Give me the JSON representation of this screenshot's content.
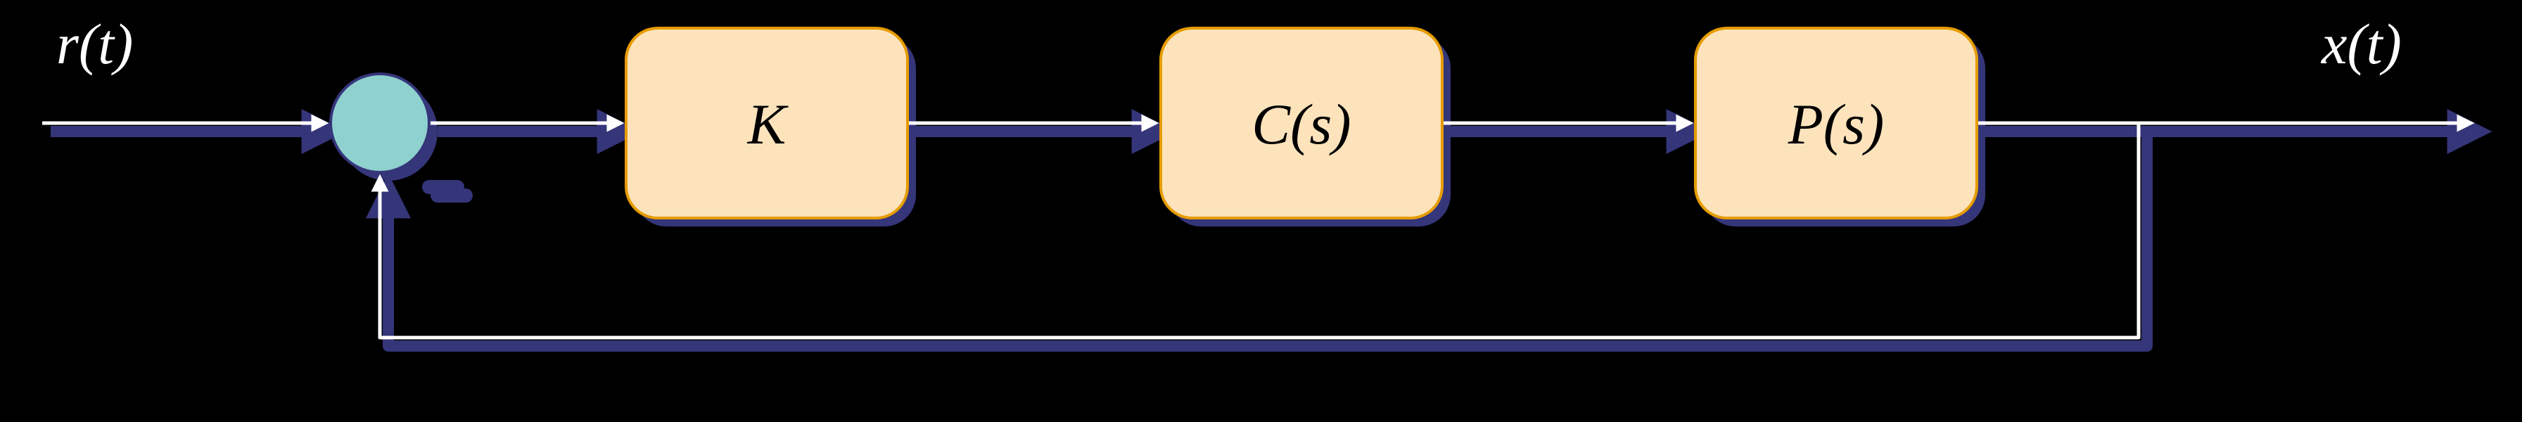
{
  "diagram": {
    "type": "control-system-block-diagram",
    "input_label": "r(t)",
    "output_label": "x(t)",
    "summing_junction": {
      "positive_input": "r(t)",
      "negative_input": "feedback",
      "sign_shown": "−"
    },
    "blocks": [
      {
        "id": "gain",
        "label": "K"
      },
      {
        "id": "controller",
        "label": "C(s)"
      },
      {
        "id": "plant",
        "label": "P(s)"
      }
    ],
    "feedback": "unity-negative",
    "colors": {
      "block_fill": "#fce3bc",
      "block_border": "#e69c00",
      "sum_fill": "#8fd1ce",
      "shadow": "#35357a",
      "wire": "#ffffff",
      "background": "#000000"
    }
  }
}
